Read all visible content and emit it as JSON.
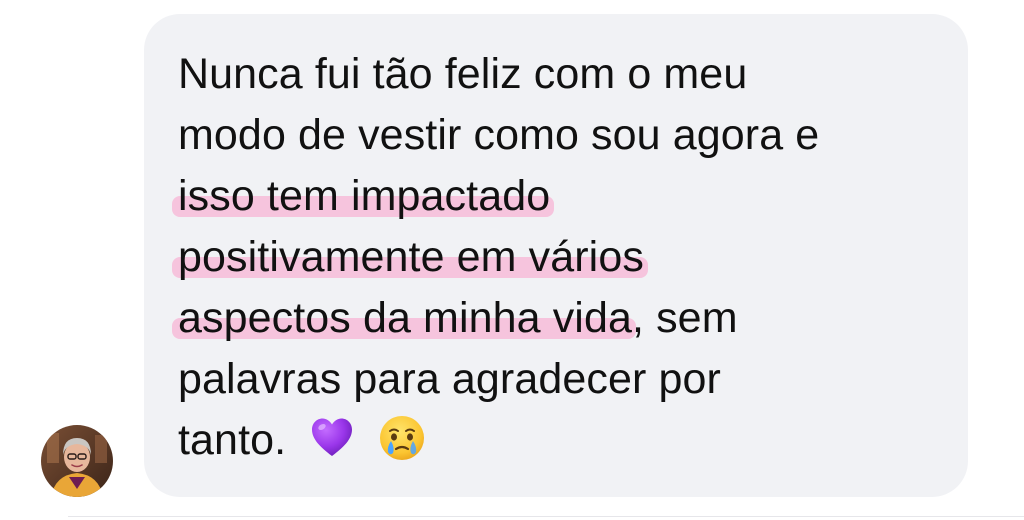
{
  "message": {
    "lines": [
      {
        "plain": "Nunca fui tão feliz com o meu"
      },
      {
        "plain": "modo de vestir como sou agora e"
      },
      {
        "highlight": "isso tem impactado"
      },
      {
        "highlight": "positivamente em vários"
      },
      {
        "highlight": "aspectos da minha vida",
        "rest": ", sem"
      },
      {
        "plain": "palavras para agradecer por"
      },
      {
        "plain": "tanto."
      }
    ],
    "emojis": [
      "purple-heart-emoji",
      "face-holding-back-tears-emoji"
    ]
  },
  "colors": {
    "bubble_bg": "#f1f2f5",
    "text": "#111111",
    "highlight": "#f6c4dd",
    "heart": "#8e2fe0"
  },
  "avatar": {
    "icon": "user-avatar-photo"
  }
}
